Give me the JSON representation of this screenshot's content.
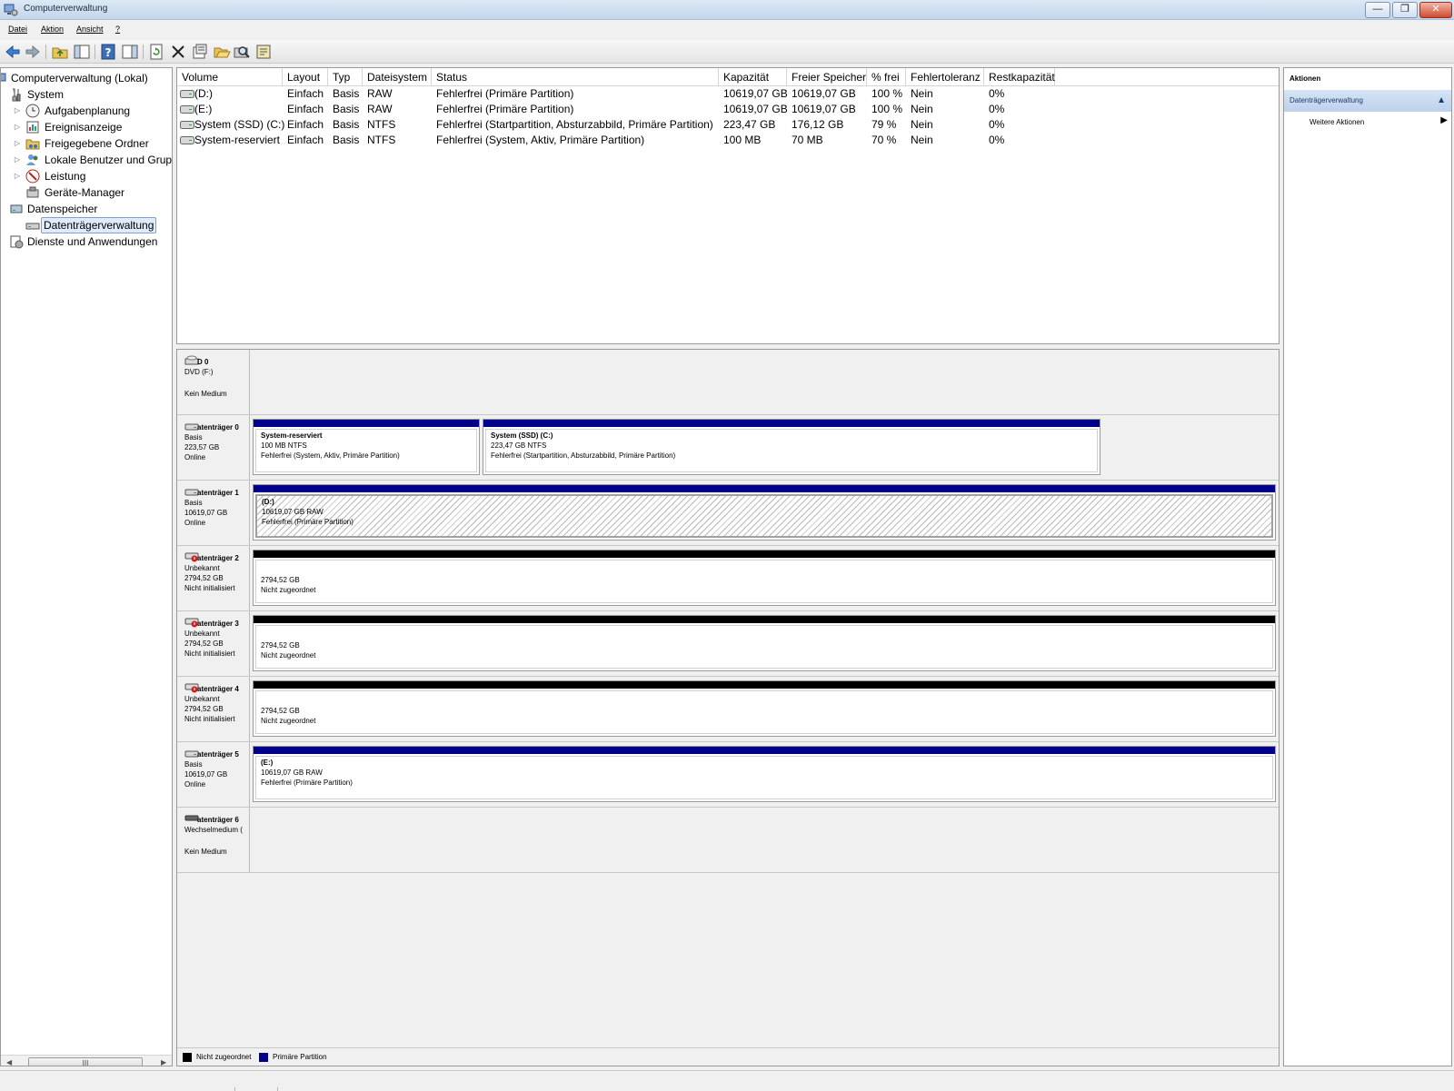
{
  "window": {
    "title": "Computerverwaltung",
    "controls": {
      "minimize": "—",
      "maximize": "❐",
      "close": "✕"
    }
  },
  "menu": [
    "Datei",
    "Aktion",
    "Ansicht",
    "?"
  ],
  "toolbar": {
    "icons": [
      "back-arrow-icon",
      "forward-arrow-icon",
      "up-folder-icon",
      "show-hide-tree-icon",
      "help-icon",
      "show-hide-action-pane-icon",
      "refresh-icon",
      "delete-icon",
      "properties-icon",
      "open-folder-icon",
      "search-disk-icon",
      "wizard-icon"
    ]
  },
  "tree": {
    "root": "Computerverwaltung (Lokal)",
    "system": "System",
    "aufgabenplanung": "Aufgabenplanung",
    "ereignisanzeige": "Ereignisanzeige",
    "freigegebene_ordner": "Freigegebene Ordner",
    "lokale_benutzer": "Lokale Benutzer und Grupp",
    "leistung": "Leistung",
    "geraete_manager": "Geräte-Manager",
    "datenspeicher": "Datenspeicher",
    "datentraegerverwaltung": "Datenträgerverwaltung",
    "dienste": "Dienste und Anwendungen",
    "scroll_thumb": "III"
  },
  "volumes": {
    "columns": [
      "Volume",
      "Layout",
      "Typ",
      "Dateisystem",
      "Status",
      "Kapazität",
      "Freier Speicher",
      "% frei",
      "Fehlertoleranz",
      "Restkapazität"
    ],
    "rows": [
      [
        "(D:)",
        "Einfach",
        "Basis",
        "RAW",
        "Fehlerfrei (Primäre Partition)",
        "10619,07 GB",
        "10619,07 GB",
        "100 %",
        "Nein",
        "0%"
      ],
      [
        "(E:)",
        "Einfach",
        "Basis",
        "RAW",
        "Fehlerfrei (Primäre Partition)",
        "10619,07 GB",
        "10619,07 GB",
        "100 %",
        "Nein",
        "0%"
      ],
      [
        "System (SSD) (C:)",
        "Einfach",
        "Basis",
        "NTFS",
        "Fehlerfrei (Startpartition, Absturzabbild, Primäre Partition)",
        "223,47 GB",
        "176,12 GB",
        "79 %",
        "Nein",
        "0%"
      ],
      [
        "System-reserviert",
        "Einfach",
        "Basis",
        "NTFS",
        "Fehlerfrei (System, Aktiv, Primäre Partition)",
        "100 MB",
        "70 MB",
        "70 %",
        "Nein",
        "0%"
      ]
    ]
  },
  "disks": {
    "cd0": {
      "name": "D 0",
      "lines": [
        "DVD (F:)",
        "",
        "Kein Medium"
      ]
    },
    "d0": {
      "name": "atenträger 0",
      "lines": [
        "Basis",
        "223,57 GB",
        "Online"
      ],
      "p1": {
        "title": "System-reserviert",
        "size": "100 MB NTFS",
        "status": "Fehlerfrei (System, Aktiv, Primäre Partition)"
      },
      "p2": {
        "title": "System (SSD)  (C:)",
        "size": "223,47 GB NTFS",
        "status": "Fehlerfrei (Startpartition, Absturzabbild, Primäre Partition)"
      }
    },
    "d1": {
      "name": "atenträger 1",
      "lines": [
        "Basis",
        "10619,07 GB",
        "Online"
      ],
      "p1": {
        "title": "(D:)",
        "size": "10619,07 GB RAW",
        "status": "Fehlerfrei (Primäre Partition)"
      }
    },
    "d2": {
      "name": "atenträger 2",
      "lines": [
        "Unbekannt",
        "2794,52 GB",
        "Nicht initialisiert"
      ],
      "p1": {
        "size": "2794,52 GB",
        "status": "Nicht zugeordnet"
      }
    },
    "d3": {
      "name": "atenträger 3",
      "lines": [
        "Unbekannt",
        "2794,52 GB",
        "Nicht initialisiert"
      ],
      "p1": {
        "size": "2794,52 GB",
        "status": "Nicht zugeordnet"
      }
    },
    "d4": {
      "name": "atenträger 4",
      "lines": [
        "Unbekannt",
        "2794,52 GB",
        "Nicht initialisiert"
      ],
      "p1": {
        "size": "2794,52 GB",
        "status": "Nicht zugeordnet"
      }
    },
    "d5": {
      "name": "atenträger 5",
      "lines": [
        "Basis",
        "10619,07 GB",
        "Online"
      ],
      "p1": {
        "title": "(E:)",
        "size": "10619,07 GB RAW",
        "status": "Fehlerfrei (Primäre Partition)"
      }
    },
    "d6": {
      "name": "atenträger 6",
      "lines": [
        "Wechselmedium (",
        "",
        "Kein Medium"
      ]
    }
  },
  "legend": {
    "unallocated": "Nicht zugeordnet",
    "primary": "Primäre Partition"
  },
  "actions": {
    "header": "Aktionen",
    "section": "Datenträgerverwaltung",
    "more": "Weitere Aktionen"
  },
  "colors": {
    "primary_partition": "#00008b",
    "unallocated": "#000000",
    "selection": "#dfeafb"
  }
}
